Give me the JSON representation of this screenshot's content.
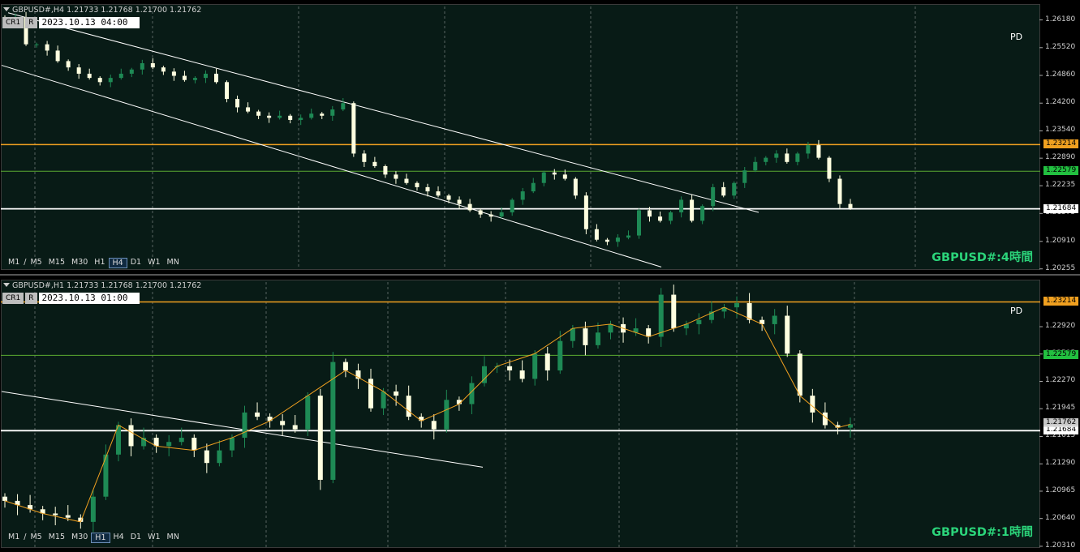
{
  "colors": {
    "background": "#081b16",
    "bull": "#1e8a55",
    "bear": "#ffffe0",
    "grid": "#c8c8c8",
    "orange_line": "#f0a020",
    "green_line": "#5aaa30",
    "white_line": "#ffffff",
    "symbol_text": "#2bd47a"
  },
  "top_panel": {
    "header": "GBPUSD#,H4  1.21733 1.21768 1.21700 1.21762",
    "crosshair_label": "CR1",
    "r_label": "R",
    "datetime": "2023.10.13 04:00",
    "timeframes": [
      "M1",
      "/",
      "M5",
      "M15",
      "M30",
      "H1",
      "H4",
      "D1",
      "W1",
      "MN"
    ],
    "selected_timeframe": "H4",
    "symbol_label": "GBPUSD#:4時間",
    "pd_label": "PD",
    "price_ticks": [
      "1.26180",
      "1.25520",
      "1.24860",
      "1.24200",
      "1.23540",
      "1.22890",
      "1.22235",
      "1.21575",
      "1.20910",
      "1.20255"
    ],
    "level_orange": "1.23214",
    "level_green": "1.22579",
    "level_white": "1.21684"
  },
  "bottom_panel": {
    "header": "GBPUSD#,H1  1.21733 1.21768 1.21700 1.21762",
    "crosshair_label": "CR1",
    "r_label": "R",
    "datetime": "2023.10.13 01:00",
    "timeframes": [
      "M1",
      "/",
      "M5",
      "M15",
      "M30",
      "H1",
      "H4",
      "D1",
      "W1",
      "MN"
    ],
    "selected_timeframe": "H1",
    "symbol_label": "GBPUSD#:1時間",
    "pd_label": "PD",
    "price_ticks": [
      "1.22920",
      "1.22595",
      "1.22270",
      "1.21945",
      "1.21615",
      "1.21290",
      "1.20965",
      "1.20640",
      "1.20310"
    ],
    "level_orange": "1.23214",
    "level_green": "1.22579",
    "level_white": "1.21684",
    "current_price": "1.21762"
  },
  "chart_data": [
    {
      "type": "candlestick",
      "title": "GBPUSD#:4時間",
      "ylim": [
        1.2025,
        1.265
      ],
      "levels": [
        1.23214,
        1.22579,
        1.21684
      ],
      "close_path": [
        1.262,
        1.2625,
        1.256,
        1.256,
        1.2545,
        1.252,
        1.2505,
        1.249,
        1.248,
        1.247,
        1.248,
        1.249,
        1.25,
        1.2515,
        1.2505,
        1.2495,
        1.2485,
        1.2475,
        1.248,
        1.249,
        1.247,
        1.243,
        1.241,
        1.24,
        1.239,
        1.2385,
        1.239,
        1.238,
        1.2385,
        1.2395,
        1.239,
        1.2405,
        1.242,
        1.23,
        1.228,
        1.227,
        1.225,
        1.224,
        1.223,
        1.222,
        1.221,
        1.22,
        1.219,
        1.218,
        1.2165,
        1.2155,
        1.215,
        1.216,
        1.219,
        1.221,
        1.223,
        1.2255,
        1.225,
        1.224,
        1.22,
        1.212,
        1.2095,
        1.209,
        1.21,
        1.2105,
        1.2165,
        1.215,
        1.214,
        1.216,
        1.219,
        1.214,
        1.2175,
        1.222,
        1.22,
        1.223,
        1.226,
        1.228,
        1.229,
        1.23,
        1.228,
        1.23,
        1.232,
        1.229,
        1.224,
        1.218,
        1.217
      ]
    },
    {
      "type": "candlestick",
      "title": "GBPUSD#:1時間",
      "ylim": [
        1.203,
        1.2345
      ],
      "levels": [
        1.23214,
        1.22579,
        1.21684
      ],
      "close_path": [
        1.2085,
        1.208,
        1.2075,
        1.207,
        1.2068,
        1.2065,
        1.206,
        1.209,
        1.214,
        1.2175,
        1.215,
        1.216,
        1.215,
        1.2155,
        1.216,
        1.2145,
        1.213,
        1.2145,
        1.216,
        1.219,
        1.2185,
        1.218,
        1.2175,
        1.217,
        1.221,
        1.211,
        1.225,
        1.224,
        1.223,
        1.2195,
        1.2215,
        1.221,
        1.2185,
        1.218,
        1.217,
        1.2205,
        1.22,
        1.2225,
        1.2245,
        1.2245,
        1.224,
        1.223,
        1.226,
        1.224,
        1.2275,
        1.229,
        1.227,
        1.2285,
        1.2295,
        1.2285,
        1.229,
        1.228,
        1.233,
        1.229,
        1.2295,
        1.23,
        1.231,
        1.2315,
        1.232,
        1.23,
        1.2295,
        1.2305,
        1.226,
        1.221,
        1.219,
        1.2175,
        1.2172,
        1.2176
      ]
    }
  ]
}
